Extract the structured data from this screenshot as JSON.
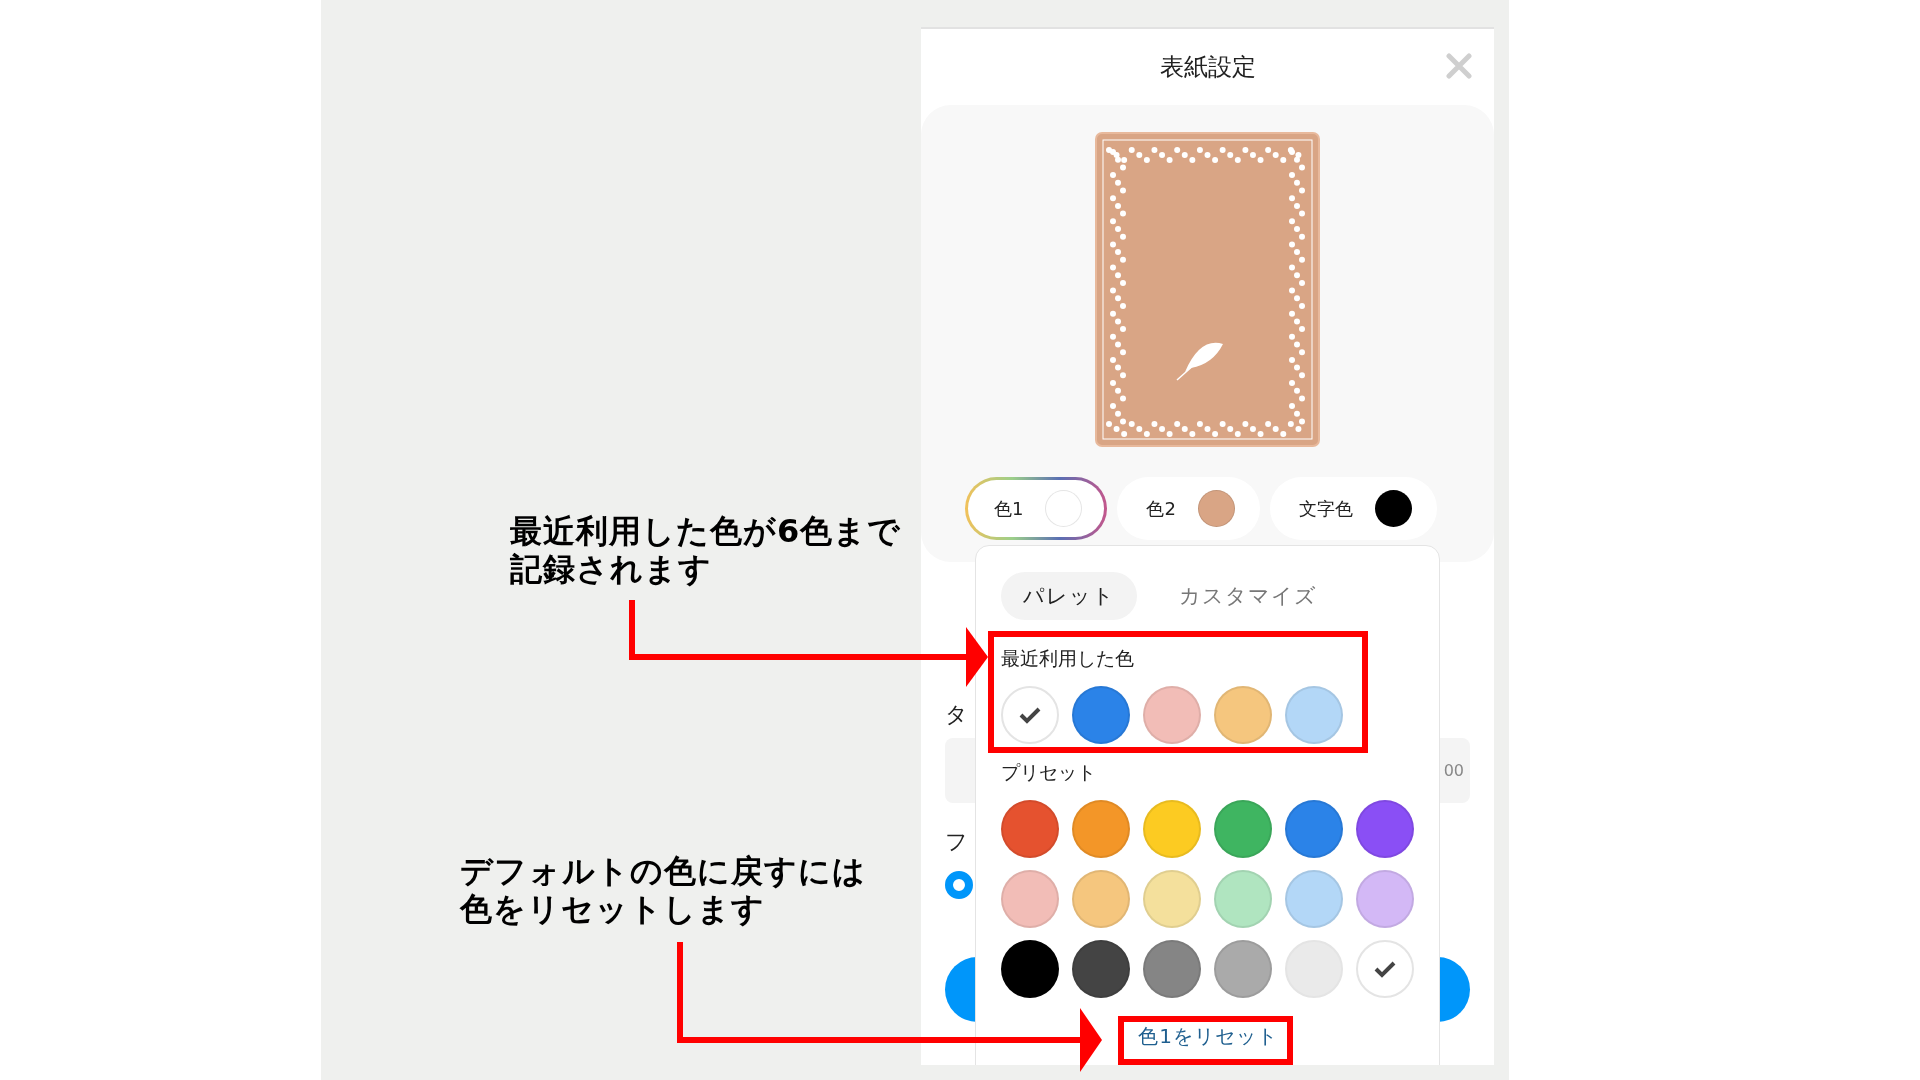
{
  "dialog": {
    "title": "表紙設定"
  },
  "color_slots": [
    {
      "label": "色1",
      "color": "#ffffff",
      "selected": true
    },
    {
      "label": "色2",
      "color": "#d9a585",
      "selected": false
    },
    {
      "label": "文字色",
      "color": "#000000",
      "selected": false
    }
  ],
  "background_form": {
    "label_1": "タ",
    "field_value": "00",
    "label_2": "フ",
    "radio_checked": true
  },
  "picker": {
    "tabs": [
      {
        "label": "パレット",
        "selected": true
      },
      {
        "label": "カスタマイズ",
        "selected": false
      }
    ],
    "recent": {
      "heading": "最近利用した色",
      "swatches": [
        {
          "color": "#ffffff",
          "selected": true
        },
        {
          "color": "#2b83e8",
          "selected": false
        },
        {
          "color": "#f2bdb7",
          "selected": false
        },
        {
          "color": "#f5c67e",
          "selected": false
        },
        {
          "color": "#b3d7f7",
          "selected": false
        }
      ]
    },
    "preset": {
      "heading": "プリセット",
      "swatches": [
        {
          "color": "#e5522f",
          "selected": false
        },
        {
          "color": "#f39628",
          "selected": false
        },
        {
          "color": "#fccb22",
          "selected": false
        },
        {
          "color": "#3fb561",
          "selected": false
        },
        {
          "color": "#2b83e8",
          "selected": false
        },
        {
          "color": "#8a4ff5",
          "selected": false
        },
        {
          "color": "#f2bdb7",
          "selected": false
        },
        {
          "color": "#f5c67e",
          "selected": false
        },
        {
          "color": "#f4e09c",
          "selected": false
        },
        {
          "color": "#b0e5c0",
          "selected": false
        },
        {
          "color": "#b3d7f7",
          "selected": false
        },
        {
          "color": "#d3b8f6",
          "selected": false
        },
        {
          "color": "#000000",
          "selected": false
        },
        {
          "color": "#444444",
          "selected": false
        },
        {
          "color": "#858585",
          "selected": false
        },
        {
          "color": "#aaaaaa",
          "selected": false
        },
        {
          "color": "#eaeaea",
          "selected": false
        },
        {
          "color": "#ffffff",
          "selected": true
        }
      ]
    },
    "reset_link": "色1をリセット"
  },
  "annotations": [
    {
      "lines": [
        "最近利用した色が6色まで",
        "記録されます"
      ]
    },
    {
      "lines": [
        "デフォルトの色に戻すには",
        "色をリセットします"
      ]
    }
  ]
}
